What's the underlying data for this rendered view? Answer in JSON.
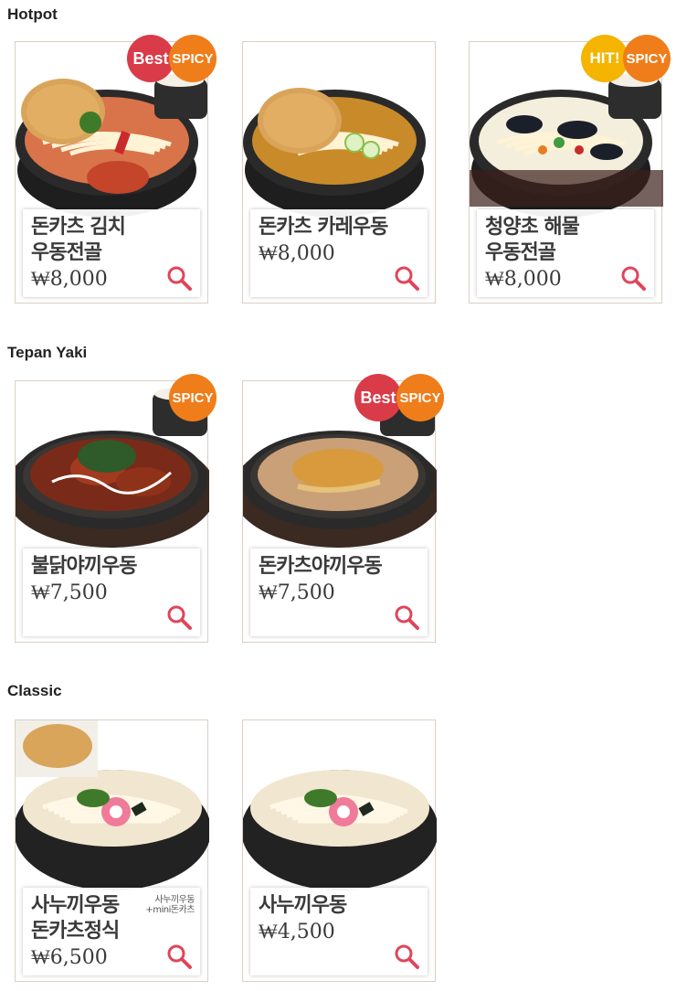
{
  "sections": [
    {
      "title": "Hotpot",
      "items": [
        {
          "name": "돈카츠 김치\n우동전골",
          "price": "₩8,000",
          "badges": [
            "Best",
            "SPICY"
          ],
          "dish": "kimchi"
        },
        {
          "name": "돈카츠 카레우동",
          "price": "₩8,000",
          "badges": [],
          "dish": "curry"
        },
        {
          "name": "청양초 해물\n우동전골",
          "price": "₩8,000",
          "badges": [
            "HIT!",
            "SPICY"
          ],
          "dish": "seafood"
        }
      ]
    },
    {
      "title": "Tepan Yaki",
      "items": [
        {
          "name": "불닭야끼우동",
          "price": "₩7,500",
          "badges": [
            "SPICY"
          ],
          "dish": "chicken"
        },
        {
          "name": "돈카츠야끼우동",
          "price": "₩7,500",
          "badges": [
            "Best",
            "SPICY"
          ],
          "dish": "yaki"
        }
      ]
    },
    {
      "title": "Classic",
      "items": [
        {
          "name": "사누끼우동\n돈카츠정식",
          "price": "₩6,500",
          "badges": [],
          "dish": "udon-set",
          "sub": "사누끼우동\n+mini돈카츠"
        },
        {
          "name": "사누끼우동",
          "price": "₩4,500",
          "badges": [],
          "dish": "udon"
        }
      ]
    }
  ],
  "colors": {
    "accent": "#e0455a",
    "border": "#d9d0c4"
  },
  "icons": {
    "zoom": "magnifier-icon"
  }
}
